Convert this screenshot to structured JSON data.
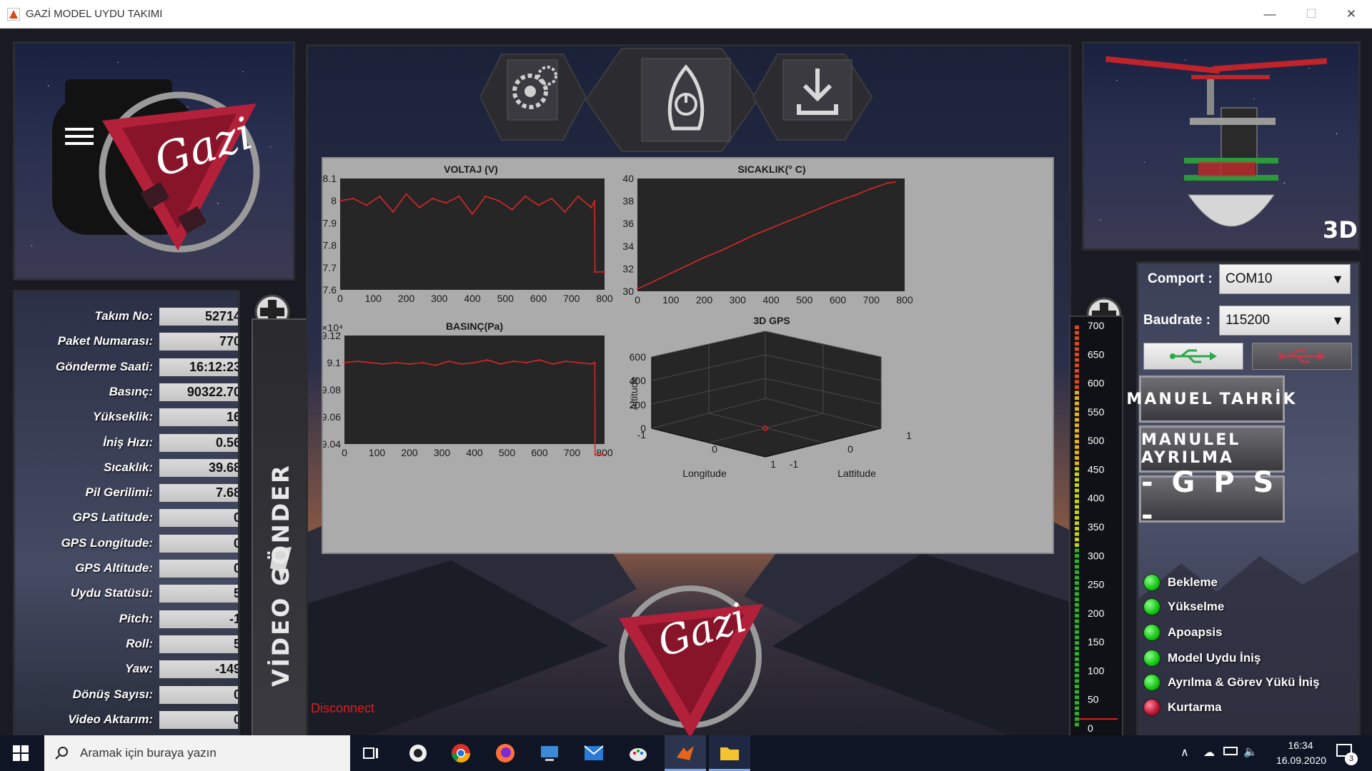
{
  "window": {
    "title": "GAZİ MODEL UYDU TAKIMI",
    "minimize": "—",
    "maximize": "☐",
    "close": "✕"
  },
  "telemetry": [
    {
      "label": "Takım No:",
      "value": "52714"
    },
    {
      "label": "Paket Numarası:",
      "value": "770"
    },
    {
      "label": "Gönderme Saati:",
      "value": "16:12:23"
    },
    {
      "label": "Basınç:",
      "value": "90322.70"
    },
    {
      "label": "Yükseklik:",
      "value": "16"
    },
    {
      "label": "İniş Hızı:",
      "value": "0.56"
    },
    {
      "label": "Sıcaklık:",
      "value": "39.68"
    },
    {
      "label": "Pil Gerilimi:",
      "value": "7.68"
    },
    {
      "label": "GPS Latitude:",
      "value": "0"
    },
    {
      "label": "GPS Longitude:",
      "value": "0"
    },
    {
      "label": "GPS Altitude:",
      "value": "0"
    },
    {
      "label": "Uydu Statüsü:",
      "value": "5"
    },
    {
      "label": "Pitch:",
      "value": "-1"
    },
    {
      "label": "Roll:",
      "value": "5"
    },
    {
      "label": "Yaw:",
      "value": "-149"
    },
    {
      "label": "Dönüş Sayısı:",
      "value": "0"
    },
    {
      "label": "Video Aktarım:",
      "value": "0"
    }
  ],
  "video_button": "VİDEO GÖNDER",
  "disconnect": "Disconnect",
  "logo_text": "Gazi",
  "model_label": "3D",
  "comport": {
    "label": "Comport :",
    "value": "COM10"
  },
  "baudrate": {
    "label": "Baudrate :",
    "value": "115200"
  },
  "buttons": {
    "manuel_tahrik_left": "MANUEL",
    "manuel_tahrik_right": "TAHRİK",
    "manuel_ayrilma": "MANULEL AYRILMA",
    "gps": "- G P S -"
  },
  "status": [
    {
      "label": "Bekleme",
      "color": "green"
    },
    {
      "label": "Yükselme",
      "color": "green"
    },
    {
      "label": "Apoapsis",
      "color": "green"
    },
    {
      "label": "Model Uydu İniş",
      "color": "green"
    },
    {
      "label": "Ayrılma & Görev Yükü İniş",
      "color": "green"
    },
    {
      "label": "Kurtarma",
      "color": "red"
    }
  ],
  "altitude_gauge": {
    "ticks": [
      "700",
      "650",
      "600",
      "550",
      "500",
      "450",
      "400",
      "350",
      "300",
      "250",
      "200",
      "150",
      "100",
      "50",
      "0"
    ],
    "value": 16,
    "max": 700
  },
  "taskbar": {
    "search_placeholder": "Aramak için buraya yazın",
    "time": "16:34",
    "date": "16.09.2020",
    "notifications": "3"
  },
  "chart_data": [
    {
      "type": "line",
      "title": "VOLTAJ (V)",
      "xlim": [
        0,
        800
      ],
      "ylim": [
        7.6,
        8.1
      ],
      "xticks": [
        "0",
        "100",
        "200",
        "300",
        "400",
        "500",
        "600",
        "700",
        "800"
      ],
      "yticks": [
        "8.1",
        "8",
        "7.9",
        "7.8",
        "7.7",
        "7.6"
      ],
      "x": [
        0,
        40,
        80,
        120,
        160,
        200,
        240,
        280,
        320,
        360,
        400,
        440,
        480,
        520,
        560,
        600,
        640,
        680,
        720,
        760,
        770,
        771,
        800
      ],
      "series": [
        {
          "values": [
            8.0,
            8.01,
            7.98,
            8.02,
            7.95,
            8.03,
            7.97,
            8.01,
            7.99,
            8.02,
            7.94,
            8.02,
            8.0,
            7.96,
            8.02,
            7.98,
            8.01,
            7.95,
            8.02,
            7.97,
            8.0,
            7.68,
            7.68
          ]
        }
      ]
    },
    {
      "type": "line",
      "title": "SICAKLIK(° C)",
      "xlim": [
        0,
        800
      ],
      "ylim": [
        30,
        40
      ],
      "xticks": [
        "0",
        "100",
        "200",
        "300",
        "400",
        "500",
        "600",
        "700",
        "800"
      ],
      "yticks": [
        "40",
        "38",
        "36",
        "34",
        "32",
        "30"
      ],
      "x": [
        0,
        50,
        100,
        150,
        200,
        250,
        300,
        350,
        400,
        450,
        500,
        550,
        600,
        650,
        700,
        750,
        770
      ],
      "series": [
        {
          "values": [
            30.2,
            30.9,
            31.6,
            32.3,
            33.0,
            33.6,
            34.3,
            35.0,
            35.6,
            36.2,
            36.8,
            37.4,
            38.0,
            38.5,
            39.1,
            39.6,
            39.68
          ]
        }
      ]
    },
    {
      "type": "line",
      "title": "BASINÇ(Pa)",
      "yscale_label": "×10⁴",
      "xlim": [
        0,
        800
      ],
      "ylim": [
        9.04,
        9.12
      ],
      "xticks": [
        "0",
        "100",
        "200",
        "300",
        "400",
        "500",
        "600",
        "700",
        "800"
      ],
      "yticks": [
        "9.12",
        "9.1",
        "9.08",
        "9.06",
        "9.04"
      ],
      "x": [
        0,
        40,
        80,
        120,
        160,
        200,
        240,
        280,
        320,
        360,
        400,
        440,
        480,
        520,
        560,
        600,
        640,
        680,
        720,
        760,
        770,
        771,
        800
      ],
      "series": [
        {
          "values": [
            9.1,
            9.101,
            9.1,
            9.099,
            9.1,
            9.099,
            9.1,
            9.098,
            9.101,
            9.099,
            9.1,
            9.102,
            9.099,
            9.101,
            9.1,
            9.102,
            9.099,
            9.101,
            9.1,
            9.099,
            9.1,
            9.032,
            9.032
          ]
        }
      ]
    },
    {
      "type": "scatter",
      "title": "3D GPS",
      "xlabel": "Longitude",
      "ylabel": "Lattitude",
      "zlabel": "Altitude",
      "zticks": [
        "0",
        "200",
        "400",
        "600"
      ],
      "points": [
        {
          "x": 0,
          "y": 0,
          "z": 0
        }
      ]
    }
  ]
}
